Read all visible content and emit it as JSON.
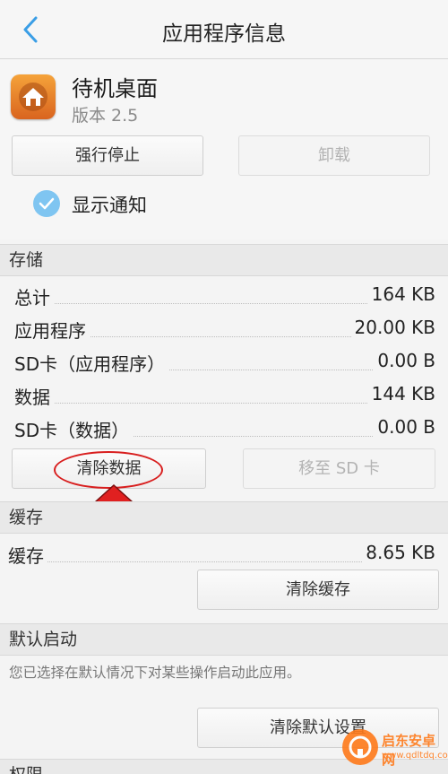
{
  "header": {
    "title": "应用程序信息",
    "back_icon": "chevron-left-icon"
  },
  "app": {
    "name": "待机桌面",
    "version": "版本 2.5",
    "icon": "home-icon"
  },
  "actions": {
    "force_stop": "强行停止",
    "uninstall": "卸载"
  },
  "notification": {
    "label": "显示通知",
    "checked": true
  },
  "storage": {
    "header": "存储",
    "rows": [
      {
        "label": "总计",
        "value": "164 KB"
      },
      {
        "label": "应用程序",
        "value": "20.00 KB"
      },
      {
        "label": "SD卡（应用程序）",
        "value": "0.00 B"
      },
      {
        "label": "数据",
        "value": "144 KB"
      },
      {
        "label": "SD卡（数据）",
        "value": "0.00 B"
      }
    ],
    "clear_data": "清除数据",
    "move_to_sd": "移至 SD 卡"
  },
  "cache": {
    "header": "缓存",
    "label": "缓存",
    "value": "8.65 KB",
    "clear": "清除缓存"
  },
  "defaults": {
    "header": "默认启动",
    "description": "您已选择在默认情况下对某些操作启动此应用。",
    "clear": "清除默认设置"
  },
  "next_section_partial": "权限",
  "watermark": {
    "name": "启东安卓网",
    "url": "www.qdltdq.com"
  },
  "colors": {
    "accent": "#7fc5f1",
    "highlight": "#d81e1e",
    "arrow": "#e02020",
    "app_icon": "#e8822c",
    "watermark": "#ff7a1a"
  }
}
